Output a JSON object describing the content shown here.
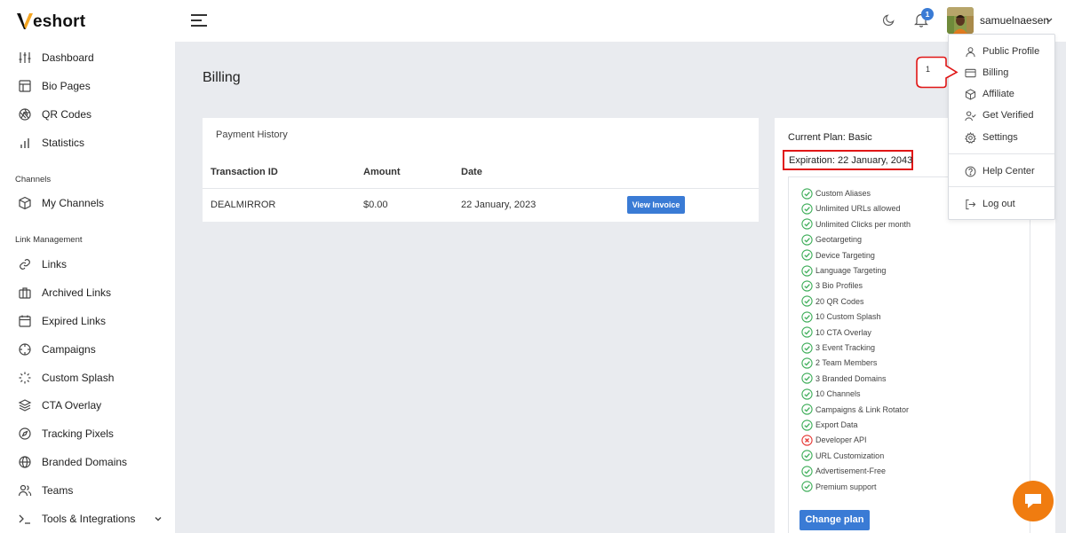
{
  "brand": {
    "logo_text": "eshort",
    "logo_letter": "V",
    "accent": "#f5a623"
  },
  "sidebar": {
    "items_top": [
      {
        "label": "Dashboard",
        "icon": "sliders-icon"
      },
      {
        "label": "Bio Pages",
        "icon": "layout-icon"
      },
      {
        "label": "QR Codes",
        "icon": "aperture-icon"
      },
      {
        "label": "Statistics",
        "icon": "bar-chart-icon"
      }
    ],
    "channels_heading": "Channels",
    "channels_items": [
      {
        "label": "My Channels",
        "icon": "box-icon"
      }
    ],
    "links_heading": "Link Management",
    "links_items": [
      {
        "label": "Links",
        "icon": "link-icon"
      },
      {
        "label": "Archived Links",
        "icon": "briefcase-icon"
      },
      {
        "label": "Expired Links",
        "icon": "calendar-icon"
      },
      {
        "label": "Campaigns",
        "icon": "crosshair-icon"
      },
      {
        "label": "Custom Splash",
        "icon": "loader-icon"
      },
      {
        "label": "CTA Overlay",
        "icon": "layers-icon"
      },
      {
        "label": "Tracking Pixels",
        "icon": "compass-icon"
      },
      {
        "label": "Branded Domains",
        "icon": "globe-icon"
      },
      {
        "label": "Teams",
        "icon": "users-icon"
      },
      {
        "label": "Tools & Integrations",
        "icon": "terminal-icon"
      }
    ]
  },
  "topbar": {
    "notification_count": "1",
    "username": "samuelnaesen"
  },
  "page": {
    "title": "Billing"
  },
  "payment_history": {
    "title": "Payment History",
    "columns": [
      "Transaction ID",
      "Amount",
      "Date"
    ],
    "rows": [
      {
        "transaction_id": "DEALMIRROR",
        "amount": "$0.00",
        "date": "22 January, 2023",
        "action": "View Invoice"
      }
    ]
  },
  "plan": {
    "current_plan": "Current Plan: Basic",
    "expiration": "Expiration: 22 January, 2043",
    "features": [
      {
        "label": "Custom Aliases",
        "included": true
      },
      {
        "label": "Unlimited URLs allowed",
        "included": true
      },
      {
        "label": "Unlimited Clicks per month",
        "included": true
      },
      {
        "label": "Geotargeting",
        "included": true
      },
      {
        "label": "Device Targeting",
        "included": true
      },
      {
        "label": "Language Targeting",
        "included": true
      },
      {
        "label": "3 Bio Profiles",
        "included": true
      },
      {
        "label": "20 QR Codes",
        "included": true
      },
      {
        "label": "10 Custom Splash",
        "included": true
      },
      {
        "label": "10 CTA Overlay",
        "included": true
      },
      {
        "label": "3 Event Tracking",
        "included": true
      },
      {
        "label": "2 Team Members",
        "included": true
      },
      {
        "label": "3 Branded Domains",
        "included": true
      },
      {
        "label": "10 Channels",
        "included": true
      },
      {
        "label": "Campaigns & Link Rotator",
        "included": true
      },
      {
        "label": "Export Data",
        "included": true
      },
      {
        "label": "Developer API",
        "included": false
      },
      {
        "label": "URL Customization",
        "included": true
      },
      {
        "label": "Advertisement-Free",
        "included": true
      },
      {
        "label": "Premium support",
        "included": true
      }
    ],
    "change_button": "Change plan"
  },
  "user_menu": {
    "items": [
      {
        "label": "Public Profile",
        "icon": "user-icon"
      },
      {
        "label": "Billing",
        "icon": "credit-card-icon"
      },
      {
        "label": "Affiliate",
        "icon": "package-icon"
      },
      {
        "label": "Get Verified",
        "icon": "user-check-icon"
      },
      {
        "label": "Settings",
        "icon": "gear-icon"
      },
      {
        "label": "Help Center",
        "icon": "help-circle-icon"
      },
      {
        "label": "Log out",
        "icon": "log-out-icon"
      }
    ]
  },
  "annotation": {
    "callout_number": "1"
  },
  "colors": {
    "primary": "#3a7bd5",
    "check": "#3fae5a",
    "cross": "#e53935",
    "highlight": "#e01616",
    "chat": "#f07c10"
  }
}
